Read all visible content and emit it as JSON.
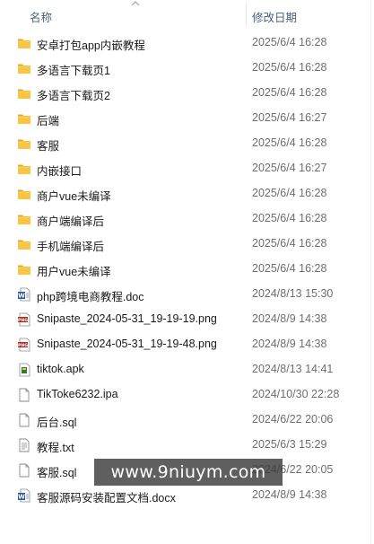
{
  "header": {
    "name_label": "名称",
    "date_label": "修改日期"
  },
  "files": [
    {
      "name": "安卓打包app内嵌教程",
      "date": "2025/6/4 16:28",
      "icon": "folder-icon"
    },
    {
      "name": "多语言下载页1",
      "date": "2025/6/4 16:28",
      "icon": "folder-icon"
    },
    {
      "name": "多语言下载页2",
      "date": "2025/6/4 16:28",
      "icon": "folder-icon"
    },
    {
      "name": "后端",
      "date": "2025/6/4 16:27",
      "icon": "folder-icon"
    },
    {
      "name": "客服",
      "date": "2025/6/4 16:28",
      "icon": "folder-icon"
    },
    {
      "name": "内嵌接口",
      "date": "2025/6/4 16:27",
      "icon": "folder-icon"
    },
    {
      "name": "商户vue未编译",
      "date": "2025/6/4 16:28",
      "icon": "folder-icon"
    },
    {
      "name": "商户端编译后",
      "date": "2025/6/4 16:28",
      "icon": "folder-icon"
    },
    {
      "name": "手机端编译后",
      "date": "2025/6/4 16:28",
      "icon": "folder-icon"
    },
    {
      "name": "用户vue未编译",
      "date": "2025/6/4 16:28",
      "icon": "folder-icon"
    },
    {
      "name": "php跨境电商教程.doc",
      "date": "2024/8/13 15:30",
      "icon": "word-doc-icon"
    },
    {
      "name": "Snipaste_2024-05-31_19-19-19.png",
      "date": "2024/8/9 14:38",
      "icon": "png-image-icon"
    },
    {
      "name": "Snipaste_2024-05-31_19-19-48.png",
      "date": "2024/8/9 14:38",
      "icon": "png-image-icon"
    },
    {
      "name": "tiktok.apk",
      "date": "2024/8/13 14:41",
      "icon": "apk-package-icon"
    },
    {
      "name": "TikToke6232.ipa",
      "date": "2024/10/30 22:28",
      "icon": "blank-file-icon"
    },
    {
      "name": "后台.sql",
      "date": "2024/6/22 20:06",
      "icon": "blank-file-icon"
    },
    {
      "name": "教程.txt",
      "date": "2025/6/3 15:29",
      "icon": "text-file-icon"
    },
    {
      "name": "客服.sql",
      "date": "2024/6/22 20:05",
      "icon": "blank-file-icon"
    },
    {
      "name": "客服源码安装配置文档.docx",
      "date": "2024/8/9 14:38",
      "icon": "word-doc-icon"
    }
  ],
  "watermark": "www.9niuym.com",
  "colors": {
    "folder": "#f5c042",
    "word": "#2b579a",
    "png": "#c0392b"
  }
}
